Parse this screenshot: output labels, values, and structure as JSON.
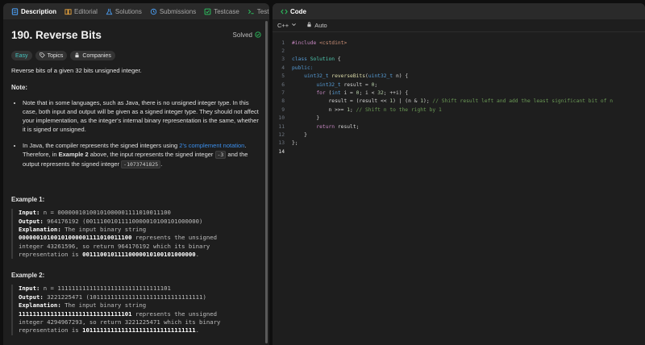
{
  "left_tabs": [
    {
      "label": "Description"
    },
    {
      "label": "Editorial"
    },
    {
      "label": "Solutions"
    },
    {
      "label": "Submissions"
    },
    {
      "label": "Testcase"
    },
    {
      "label": "Test Res"
    }
  ],
  "problem": {
    "title": "190. Reverse Bits",
    "status": "Solved",
    "tags": [
      "Easy",
      "Topics",
      "Companies"
    ],
    "description": "Reverse bits of a given 32 bits unsigned integer.",
    "note_title": "Note:",
    "note1": "Note that in some languages, such as Java, there is no unsigned integer type. In this case, both input and output will be given as a signed integer type. They should not affect your implementation, as the integer's internal binary representation is the same, whether it is signed or unsigned.",
    "note2_a": "In Java, the compiler represents the signed integers using ",
    "note2_link": "2's complement notation",
    "note2_b": ". Therefore, in ",
    "note2_bold": "Example 2",
    "note2_c": " above, the input represents the signed integer ",
    "note2_code1": "-3",
    "note2_d": " and the output represents the signed integer ",
    "note2_code2": "-1073741825",
    "note2_e": "."
  },
  "examples": [
    {
      "title": "Example 1:",
      "input_label": "Input:",
      "input": " n = 00000010100101000001111010011100",
      "output_label": "Output:",
      "output": "    964176192 (00111001011110000010100101000000)",
      "expl_label": "Explanation:",
      "expl1": " The input binary string",
      "expl2_bold": "00000010100101000001111010011100",
      "expl2": " represents the unsigned",
      "expl3": "integer 43261596, so return 964176192 which its binary",
      "expl4": "representation is ",
      "expl4_bold": "00111001011110000010100101000000",
      "expl4_end": "."
    },
    {
      "title": "Example 2:",
      "input_label": "Input:",
      "input": " n = 11111111111111111111111111111101",
      "output_label": "Output:",
      "output": "   3221225471 (10111111111111111111111111111111)",
      "expl_label": "Explanation:",
      "expl1": " The input binary string",
      "expl2_bold": "11111111111111111111111111111101",
      "expl2": " represents the unsigned",
      "expl3": "integer 4294967293, so return 3221225471 which its binary",
      "expl4": "representation is ",
      "expl4_bold": "10111111111111111111111111111111",
      "expl4_end": "."
    }
  ],
  "code_panel": {
    "title": "Code",
    "language": "C++",
    "mode": "Auto",
    "line_numbers": [
      "1",
      "2",
      "3",
      "4",
      "5",
      "6",
      "7",
      "8",
      "9",
      "10",
      "11",
      "12",
      "13",
      "14"
    ],
    "lines": {
      "l1_pp": "#include",
      "l1_inc": " <cstdint>",
      "l3_kw": "class",
      "l3_ty": " Solution",
      "l3_rest": " {",
      "l4": "public:",
      "l5_ind": "    ",
      "l5_ty": "uint32_t",
      "l5_fn": " reverseBits",
      "l5_p1": "(",
      "l5_ty2": "uint32_t",
      "l5_p2": " n) {",
      "l6_ind": "        ",
      "l6_ty": "uint32_t",
      "l6_a": " result = ",
      "l6_num": "0",
      "l6_b": ";",
      "l7_ind": "        ",
      "l7_kw": "for",
      "l7_a": " (",
      "l7_kw2": "int",
      "l7_b": " i = ",
      "l7_n1": "0",
      "l7_c": "; i < ",
      "l7_n2": "32",
      "l7_d": "; ++i) {",
      "l8_ind": "            ",
      "l8_a": "result = (result << ",
      "l8_n1": "1",
      "l8_b": ") | (n & ",
      "l8_n2": "1",
      "l8_c": "); ",
      "l8_cm": "// Shift result left and add the least significant bit of n",
      "l9_ind": "            ",
      "l9_a": "n >>= ",
      "l9_n": "1",
      "l9_b": "; ",
      "l9_cm": "// Shift n to the right by 1",
      "l10": "        }",
      "l11_ind": "        ",
      "l11_kw": "return",
      "l11_a": " result;",
      "l12": "    }",
      "l13": "};"
    }
  },
  "colors": {
    "accent_link": "#3b8eea",
    "easy": "#46c6c2",
    "solved": "#2cbb5d"
  }
}
